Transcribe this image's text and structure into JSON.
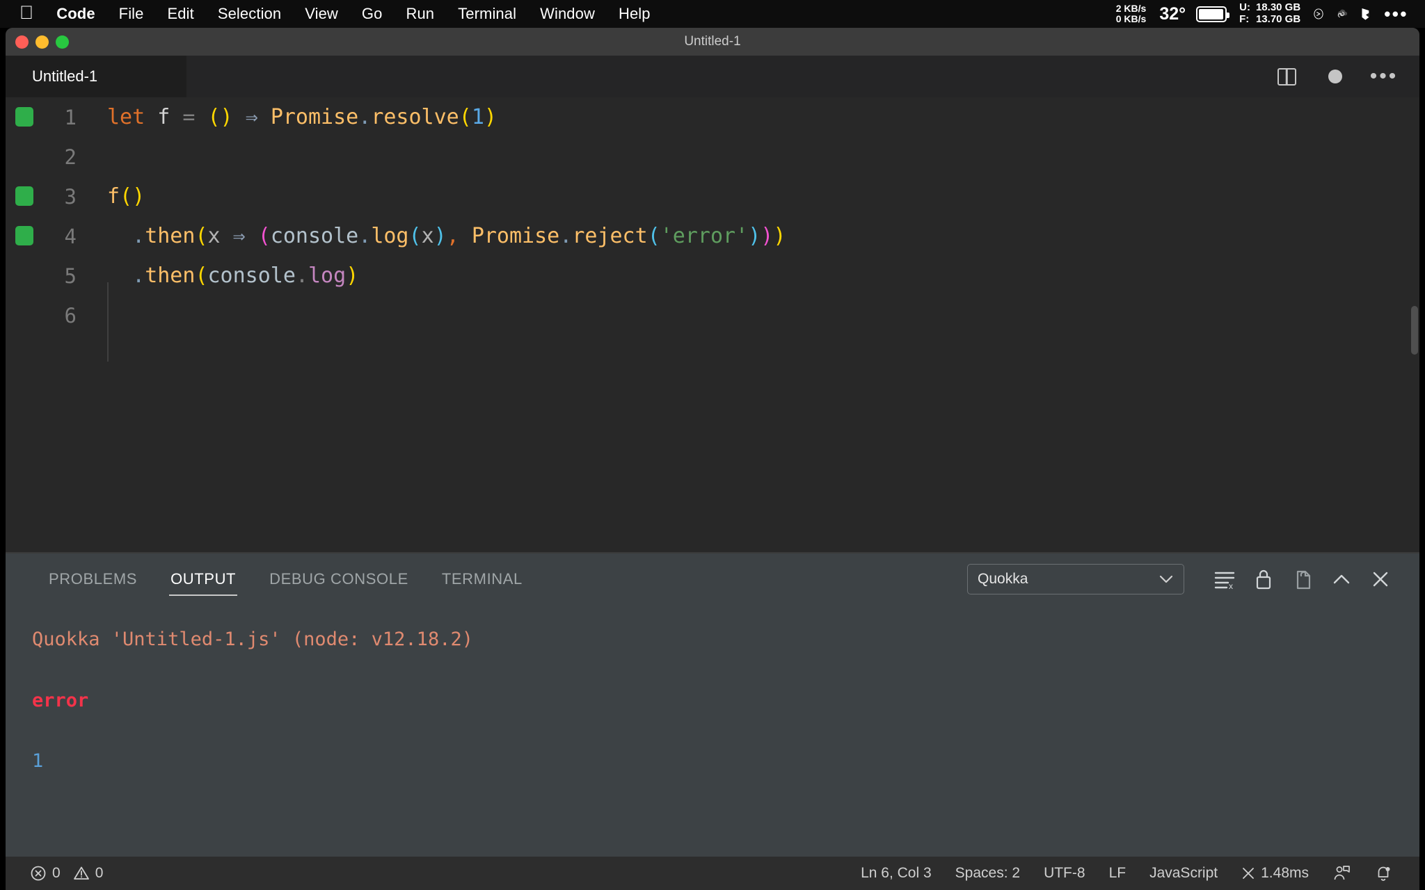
{
  "macos_menubar": {
    "apple_icon": "apple-logo",
    "menus": [
      {
        "label": "Code",
        "bold": true
      },
      {
        "label": "File",
        "bold": false
      },
      {
        "label": "Edit",
        "bold": false
      },
      {
        "label": "Selection",
        "bold": false
      },
      {
        "label": "View",
        "bold": false
      },
      {
        "label": "Go",
        "bold": false
      },
      {
        "label": "Run",
        "bold": false
      },
      {
        "label": "Terminal",
        "bold": false
      },
      {
        "label": "Window",
        "bold": false
      },
      {
        "label": "Help",
        "bold": false
      }
    ],
    "tray": {
      "net_up": "2 KB/s",
      "net_down": "0 KB/s",
      "temperature": "32°",
      "battery_icon": "battery-icon",
      "disk_used_label": "U:",
      "disk_used_value": "18.30 GB",
      "disk_free_label": "F:",
      "disk_free_value": "13.70 GB",
      "shell_icon": "terminal-circle-icon",
      "cloud_icon": "cloud-sync-icon",
      "flag_icon": "bookmark-icon",
      "overflow_icon": "ellipsis-icon"
    }
  },
  "window": {
    "title": "Untitled-1",
    "traffic_lights": {
      "close_color": "#ff5f57",
      "minimize_color": "#febc2e",
      "maximize_color": "#28c840"
    }
  },
  "editor": {
    "tab_label": "Untitled-1",
    "actions": {
      "split_editor": "split-editor-icon",
      "unsaved_dot": "unsaved-dot-icon",
      "more": "more-actions-icon"
    },
    "lines": [
      {
        "number": "1",
        "has_breakpoint_marker": true
      },
      {
        "number": "2",
        "has_breakpoint_marker": false
      },
      {
        "number": "3",
        "has_breakpoint_marker": true
      },
      {
        "number": "4",
        "has_breakpoint_marker": true
      },
      {
        "number": "5",
        "has_breakpoint_marker": false
      },
      {
        "number": "6",
        "has_breakpoint_marker": false
      }
    ],
    "code": {
      "line1": "let f = () ⇒ Promise.resolve(1)",
      "line2": "",
      "line3": "f()",
      "line4": "  .then(x ⇒ (console.log(x), Promise.reject('error')))",
      "line5": "  .then(console.log)",
      "line6": ""
    },
    "tokens": {
      "kw_let": "let",
      "ident_f": "f",
      "eq": "=",
      "arrow": "⇒",
      "promise": "Promise",
      "dot": ".",
      "resolve": "resolve",
      "num_one": "1",
      "then": "then",
      "x": "x",
      "console": "console",
      "log": "log",
      "comma": ",",
      "reject": "reject",
      "str_error": "'error'",
      "paren_open": "(",
      "paren_close": ")",
      "space": " "
    },
    "colors": {
      "keyword": "#e0712a",
      "function": "#fdbf68",
      "number": "#5aa9e6",
      "string": "#5f9e5f",
      "bracket_yellow": "#ffd700",
      "bracket_magenta": "#f252d0",
      "bracket_blue": "#4fc1e9",
      "breakpoint_green": "#2fae4a",
      "background": "#282828"
    }
  },
  "panel": {
    "tabs": [
      {
        "label": "PROBLEMS",
        "active": false
      },
      {
        "label": "OUTPUT",
        "active": true
      },
      {
        "label": "DEBUG CONSOLE",
        "active": false
      },
      {
        "label": "TERMINAL",
        "active": false
      }
    ],
    "channel_select": {
      "value": "Quokka",
      "chevron": "chevron-down-icon"
    },
    "toolbar": {
      "clear_output": "clear-output-icon",
      "lock_scroll": "lock-icon",
      "open_in_editor": "open-in-editor-icon",
      "collapse": "chevron-up-icon",
      "close": "close-icon"
    },
    "output": {
      "header": "Quokka 'Untitled-1.js' (node: v12.18.2)",
      "error_line": "error",
      "value_line": "1"
    }
  },
  "status_bar": {
    "left": {
      "errors_icon": "error-circle-icon",
      "errors_count": "0",
      "warnings_icon": "warning-triangle-icon",
      "warnings_count": "0"
    },
    "right": {
      "cursor_position": "Ln 6, Col 3",
      "indentation": "Spaces: 2",
      "encoding": "UTF-8",
      "eol": "LF",
      "language": "JavaScript",
      "quokka_time": "1.48ms",
      "quokka_icon": "close-x-icon",
      "feedback_icon": "feedback-icon",
      "bell_icon": "bell-icon"
    }
  }
}
